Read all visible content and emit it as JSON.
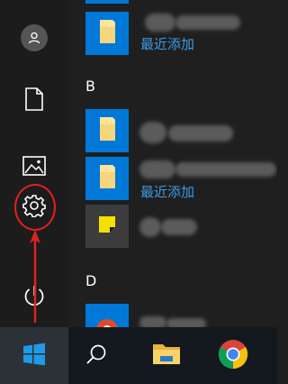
{
  "start_menu": {
    "rail": {
      "items": [
        {
          "name": "user",
          "icon": "user-icon"
        },
        {
          "name": "documents",
          "icon": "document-icon"
        },
        {
          "name": "pictures",
          "icon": "picture-icon"
        },
        {
          "name": "settings",
          "icon": "gear-icon"
        },
        {
          "name": "power",
          "icon": "power-icon"
        }
      ]
    },
    "app_list": {
      "sections": [
        {
          "letter": ""
        },
        {
          "letter": "B"
        },
        {
          "letter": "D"
        }
      ],
      "recent_label_1": "最近添加",
      "recent_label_2": "最近添加"
    }
  },
  "taskbar": {
    "items": [
      {
        "name": "start",
        "icon": "windows-logo-icon"
      },
      {
        "name": "search",
        "icon": "search-icon"
      },
      {
        "name": "file-explorer",
        "icon": "folder-icon"
      },
      {
        "name": "chrome",
        "icon": "chrome-icon"
      }
    ]
  },
  "colors": {
    "accent": "#0078d7",
    "recent_text": "#3b9be6",
    "annotation": "#e02020",
    "background": "#1f1f1f"
  }
}
